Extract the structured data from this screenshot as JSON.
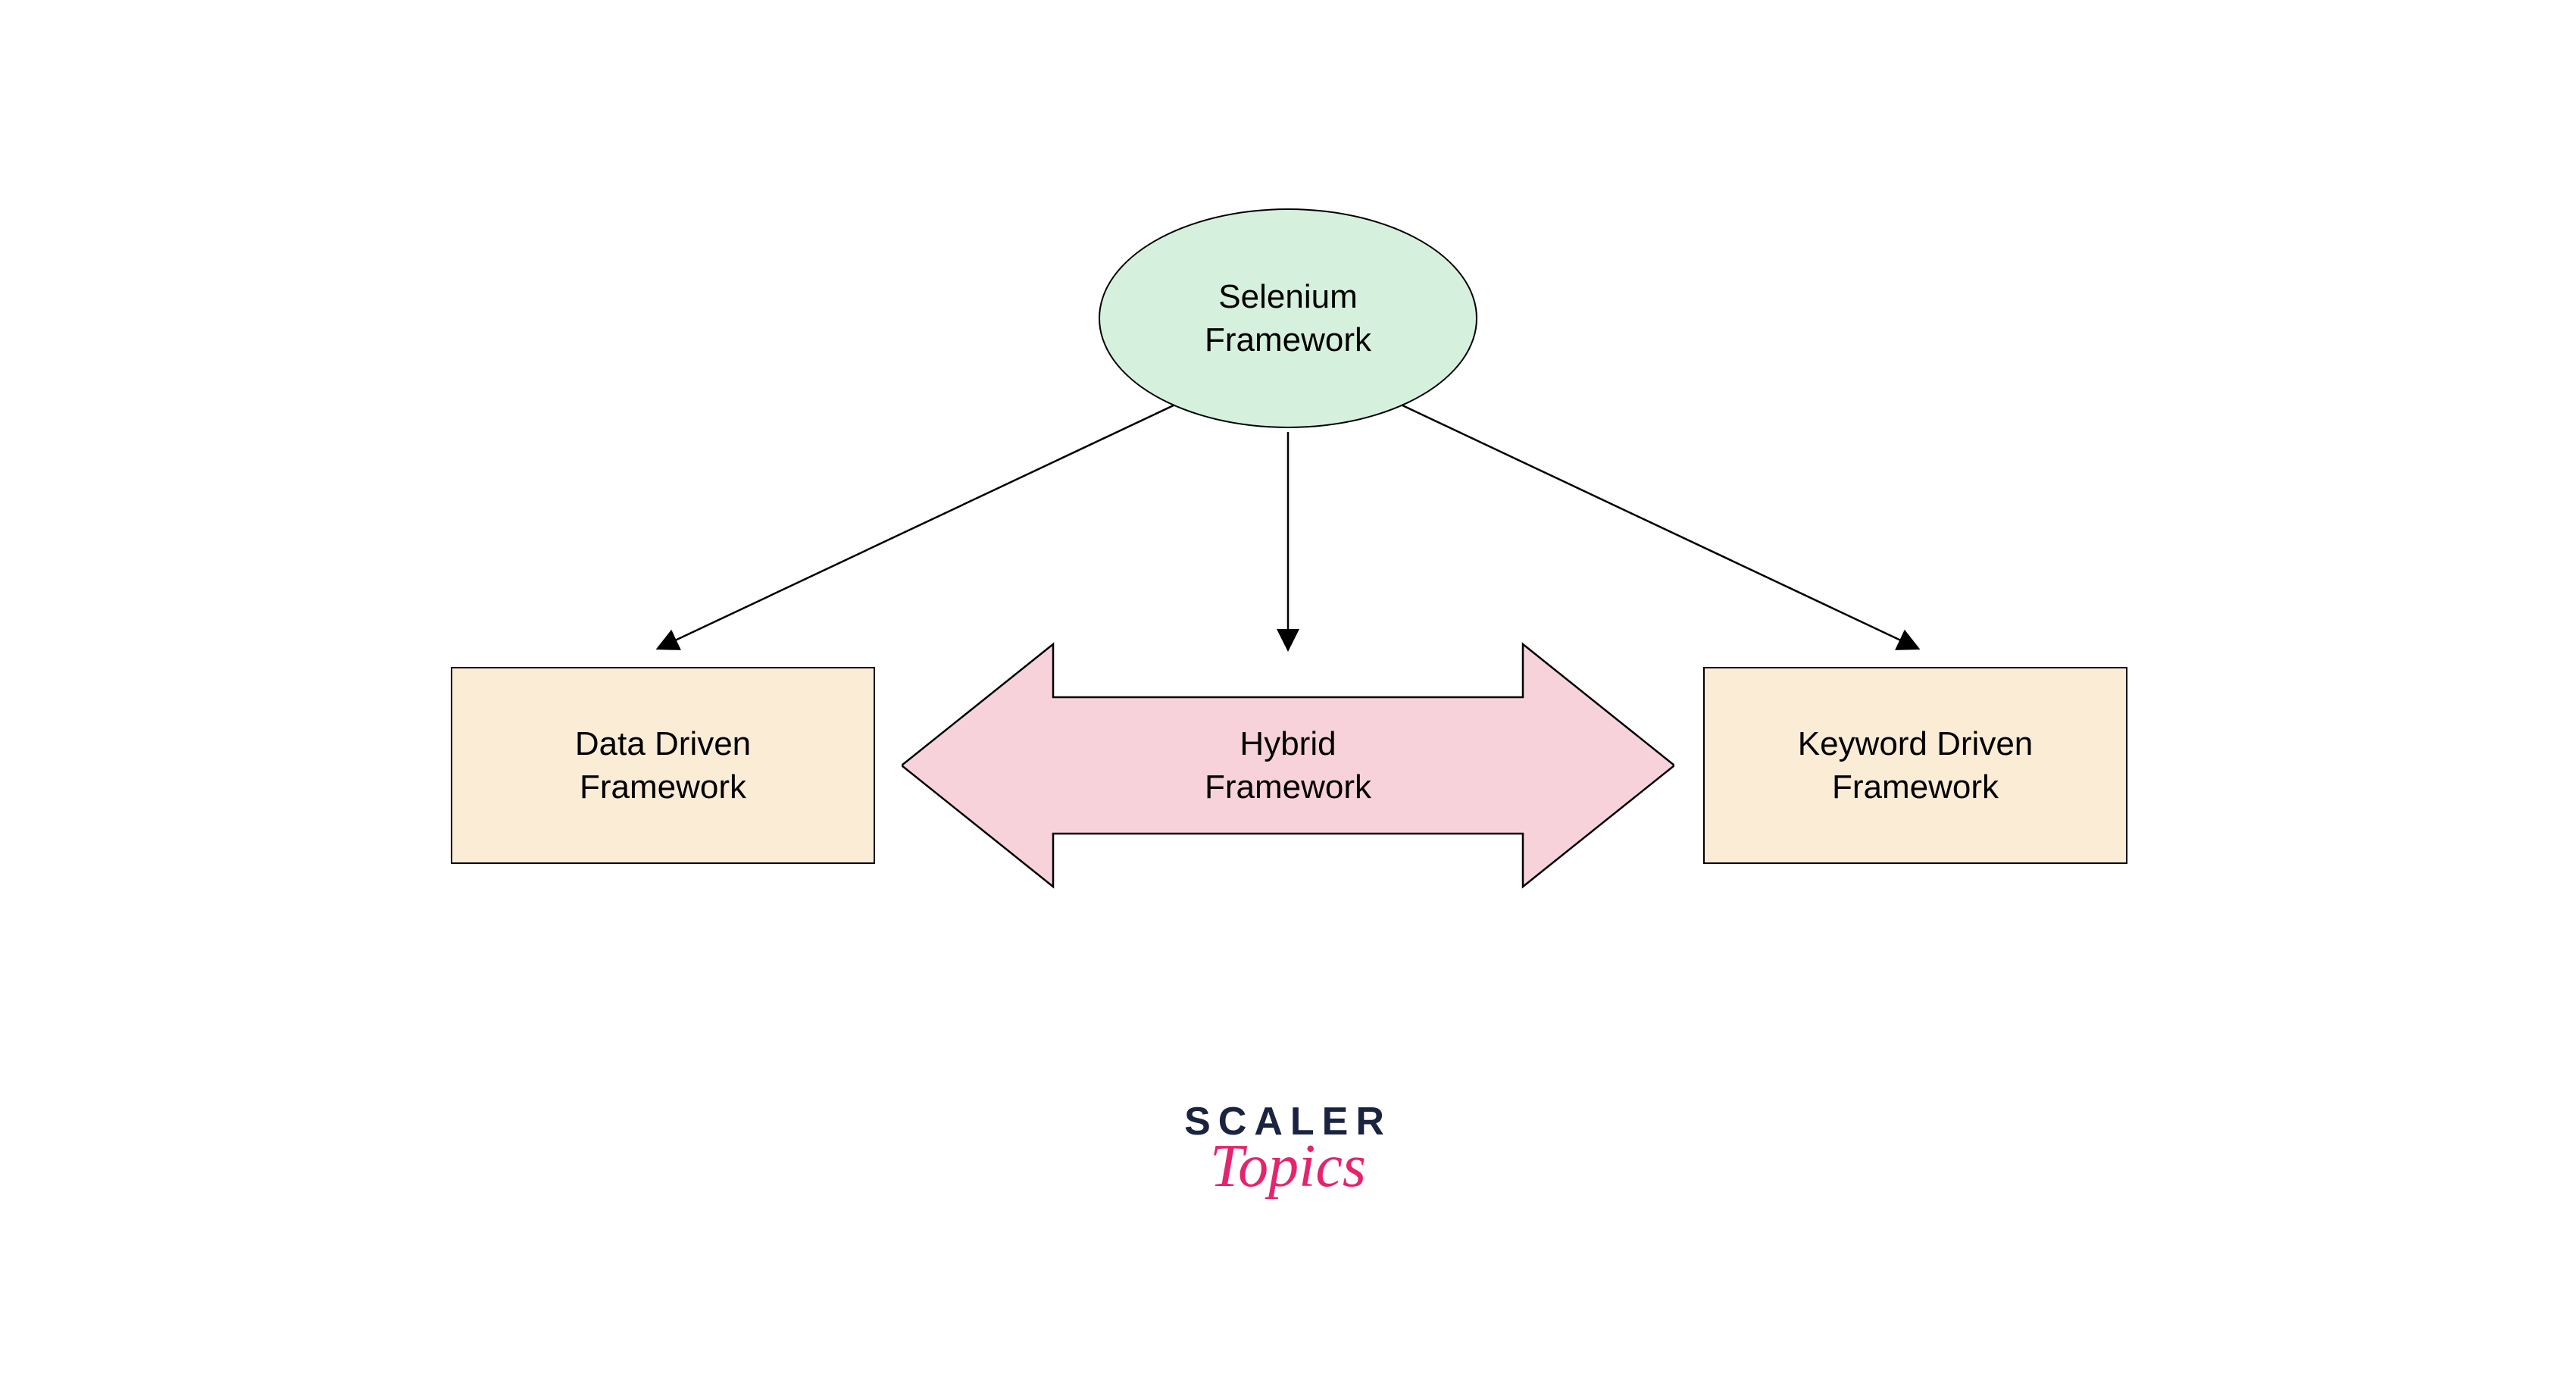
{
  "diagram": {
    "root": {
      "line1": "Selenium",
      "line2": "Framework"
    },
    "left": {
      "line1": "Data Driven",
      "line2": "Framework"
    },
    "center": {
      "line1": "Hybrid",
      "line2": "Framework"
    },
    "right": {
      "line1": "Keyword Driven",
      "line2": "Framework"
    }
  },
  "logo": {
    "main": "SCALER",
    "sub": "Topics"
  },
  "colors": {
    "ellipse_fill": "#d6f0de",
    "rect_fill": "#fbecd6",
    "arrow_fill": "#f8d2db",
    "border": "#000000",
    "logo_main": "#1a2340",
    "logo_sub": "#e6236d"
  }
}
